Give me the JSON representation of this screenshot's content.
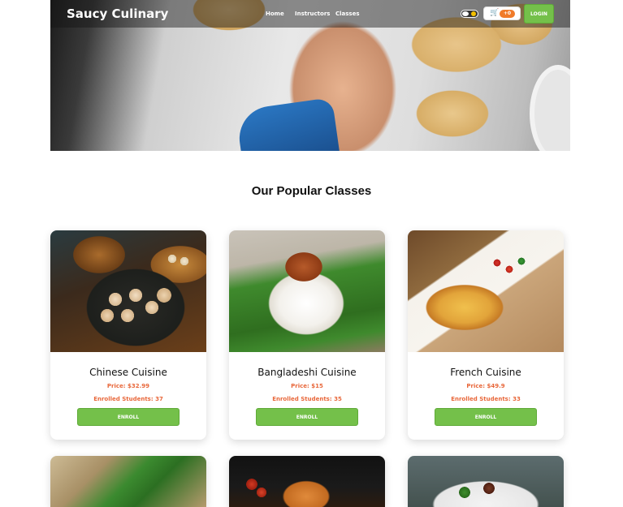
{
  "header": {
    "brand": "Saucy Culinary",
    "nav": [
      {
        "label": "Home"
      },
      {
        "label": "Instructors"
      },
      {
        "label": "Classes"
      }
    ],
    "cart_badge": "+0",
    "login_label": "LOGIN",
    "cart_icon": "cart-icon",
    "theme_toggle_icon": "theme-toggle"
  },
  "section_title": "Our Popular Classes",
  "cards": [
    {
      "name": "Chinese Cuisine",
      "price": "Price: $32.99",
      "enrolled": "Enrolled Students: 37",
      "button": "ENROLL"
    },
    {
      "name": "Bangladeshi Cuisine",
      "price": "Price: $15",
      "enrolled": "Enrolled Students: 35",
      "button": "ENROLL"
    },
    {
      "name": "French Cuisine",
      "price": "Price: $49.9",
      "enrolled": "Enrolled Students: 33",
      "button": "ENROLL"
    }
  ],
  "colors": {
    "accent_green": "#74c04a",
    "price_orange": "#e8673a",
    "badge_orange": "#f07b2a"
  }
}
